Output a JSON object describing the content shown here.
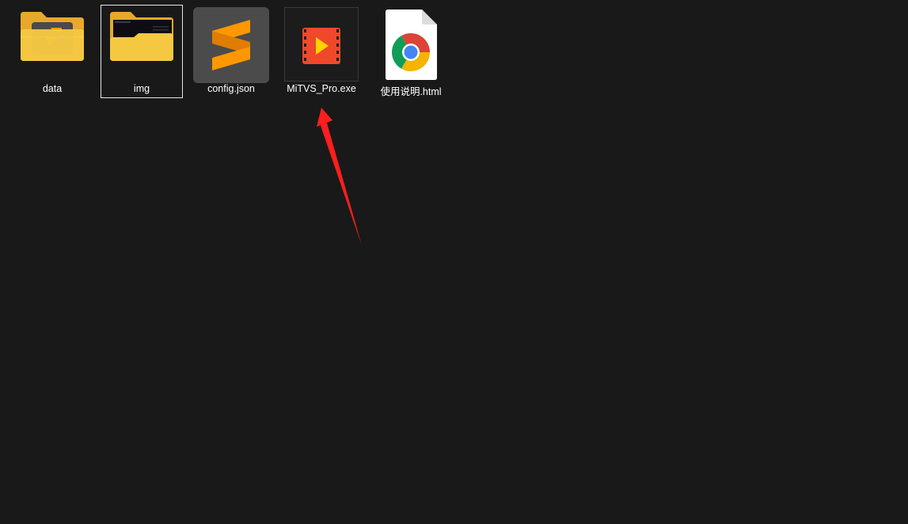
{
  "desktop": {
    "items": [
      {
        "label": "data",
        "icon": "folder-icon"
      },
      {
        "label": "img",
        "icon": "folder-icon",
        "selected": true
      },
      {
        "label": "config.json",
        "icon": "sublime-text-icon"
      },
      {
        "label": "MiTVS_Pro.exe",
        "icon": "video-app-icon"
      },
      {
        "label": "使用说明.html",
        "icon": "chrome-html-icon"
      }
    ]
  },
  "colors": {
    "background": "#191919",
    "folder": "#f5c842",
    "sublime": "#ff9800",
    "app": "#f0482b",
    "arrow": "#ff1e1e"
  }
}
